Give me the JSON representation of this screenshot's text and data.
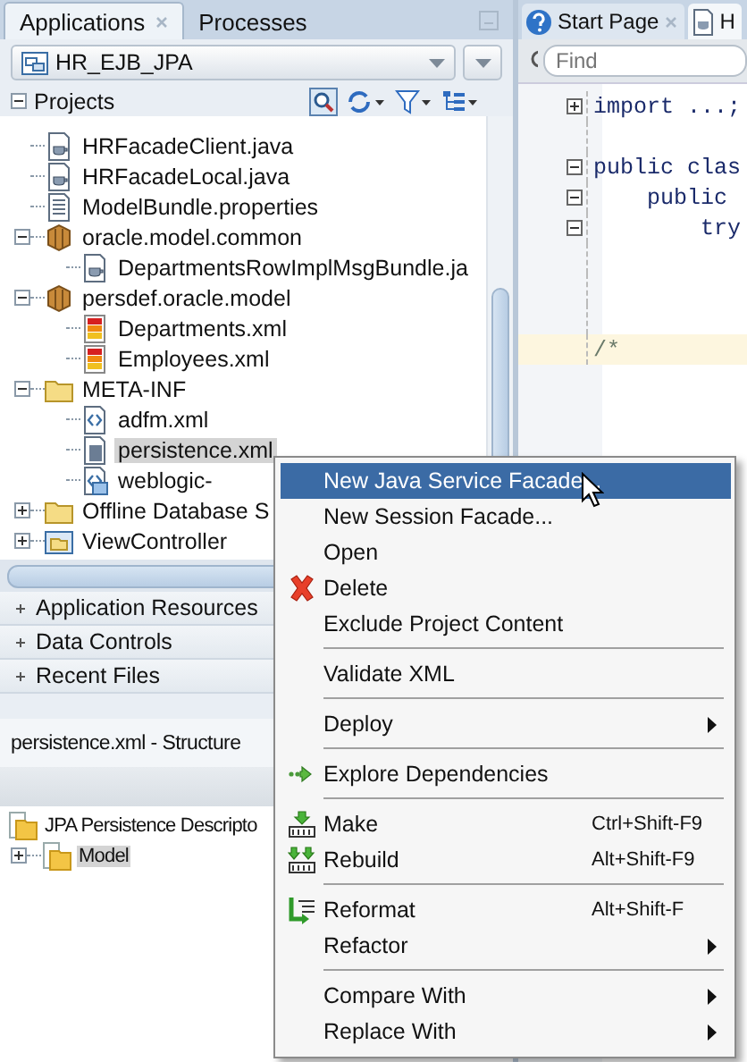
{
  "left_panel": {
    "tabs": [
      {
        "label": "Applications",
        "selected": true,
        "closable": true
      },
      {
        "label": "Processes",
        "selected": false,
        "closable": false
      }
    ],
    "application_selector": {
      "value": "HR_EJB_JPA"
    },
    "projects": {
      "title": "Projects",
      "expanded": true,
      "tree": [
        {
          "children": [
            {
              "children": [
                {
                  "children": [
                    {
                      "label": "HRFacadeClient.java",
                      "kind": "java",
                      "selected": false
                    },
                    {
                      "label": "HRFacadeLocal.java",
                      "kind": "java",
                      "selected": false
                    },
                    {
                      "label": "ModelBundle.properties",
                      "kind": "properties",
                      "selected": false
                    }
                  ]
                },
                {
                  "label": "oracle.model.common",
                  "kind": "package",
                  "selected": false,
                  "expanded": true,
                  "children": [
                    {
                      "label": "DepartmentsRowImplMsgBundle.ja",
                      "kind": "java",
                      "selected": false
                    }
                  ]
                },
                {
                  "label": "persdef.oracle.model",
                  "kind": "package",
                  "selected": false,
                  "expanded": true,
                  "children": [
                    {
                      "label": "Departments.xml",
                      "kind": "table",
                      "selected": false
                    },
                    {
                      "label": "Employees.xml",
                      "kind": "table",
                      "selected": false
                    }
                  ]
                },
                {
                  "label": "META-INF",
                  "kind": "folder",
                  "selected": false,
                  "expanded": true,
                  "children": [
                    {
                      "label": "adfm.xml",
                      "kind": "xml",
                      "selected": false
                    },
                    {
                      "label": "persistence.xml",
                      "kind": "database",
                      "selected": true
                    },
                    {
                      "label": "weblogic-",
                      "kind": "weblogic",
                      "selected": false
                    }
                  ]
                }
              ]
            },
            {
              "label": "Offline Database S",
              "kind": "folder",
              "selected": false,
              "expanded": false
            }
          ]
        },
        {
          "label": "ViewController",
          "kind": "project",
          "selected": false,
          "expanded": false
        }
      ]
    },
    "sections": [
      {
        "title": "Application Resources",
        "expanded": false
      },
      {
        "title": "Data Controls",
        "expanded": false
      },
      {
        "title": "Recent Files",
        "expanded": false
      }
    ],
    "structure": {
      "title": "persistence.xml - Structure",
      "tree": [
        {
          "label": "JPA Persistence Descripto",
          "selected": false,
          "children": [
            {
              "label": "Model",
              "selected": true,
              "expanded": false
            }
          ]
        }
      ]
    }
  },
  "editor": {
    "tabs": [
      {
        "label": "Start Page",
        "kind": "help",
        "selected": false,
        "closable": true
      },
      {
        "label": "H",
        "kind": "java",
        "selected": true,
        "closable": false
      }
    ],
    "find": {
      "placeholder": "Find"
    },
    "code_lines": [
      {
        "text": "import ...;",
        "folded": true,
        "highlighted": false
      },
      {
        "highlighted": false
      },
      {
        "text": "public clas",
        "folded": false,
        "highlighted": false
      },
      {
        "text": "    public",
        "folded": false,
        "highlighted": false
      },
      {
        "text": "        try",
        "folded": false,
        "highlighted": false
      },
      {
        "highlighted": false
      },
      {
        "highlighted": false
      },
      {
        "highlighted": false
      },
      {
        "text": "/*",
        "highlighted": true
      }
    ]
  },
  "context_menu": [
    {
      "kind": "item",
      "label": "New Java Service Facade...",
      "selected": true
    },
    {
      "kind": "item",
      "label": "New Session Facade...",
      "selected": false
    },
    {
      "kind": "item",
      "label": "Open",
      "selected": false
    },
    {
      "kind": "delete",
      "label": "Delete",
      "selected": false
    },
    {
      "kind": "item",
      "label": "Exclude Project Content",
      "selected": false
    },
    {
      "kind": "separator"
    },
    {
      "kind": "item",
      "label": "Validate XML",
      "selected": false
    },
    {
      "kind": "separator"
    },
    {
      "kind": "item",
      "label": "Deploy",
      "submenu": true,
      "selected": false
    },
    {
      "kind": "separator"
    },
    {
      "kind": "explore",
      "label": "Explore Dependencies",
      "selected": false
    },
    {
      "kind": "separator"
    },
    {
      "kind": "make",
      "label": "Make",
      "shortcut": "Ctrl+Shift-F9",
      "selected": false
    },
    {
      "kind": "rebuild",
      "label": "Rebuild",
      "shortcut": "Alt+Shift-F9",
      "selected": false
    },
    {
      "kind": "separator"
    },
    {
      "kind": "reformat",
      "label": "Reformat",
      "shortcut": "Alt+Shift-F",
      "selected": false
    },
    {
      "kind": "item",
      "label": "Refactor",
      "submenu": true,
      "selected": false
    },
    {
      "kind": "separator"
    },
    {
      "kind": "item",
      "label": "Compare With",
      "submenu": true,
      "selected": false
    },
    {
      "kind": "item",
      "label": "Replace With",
      "submenu": true,
      "selected": false
    }
  ]
}
